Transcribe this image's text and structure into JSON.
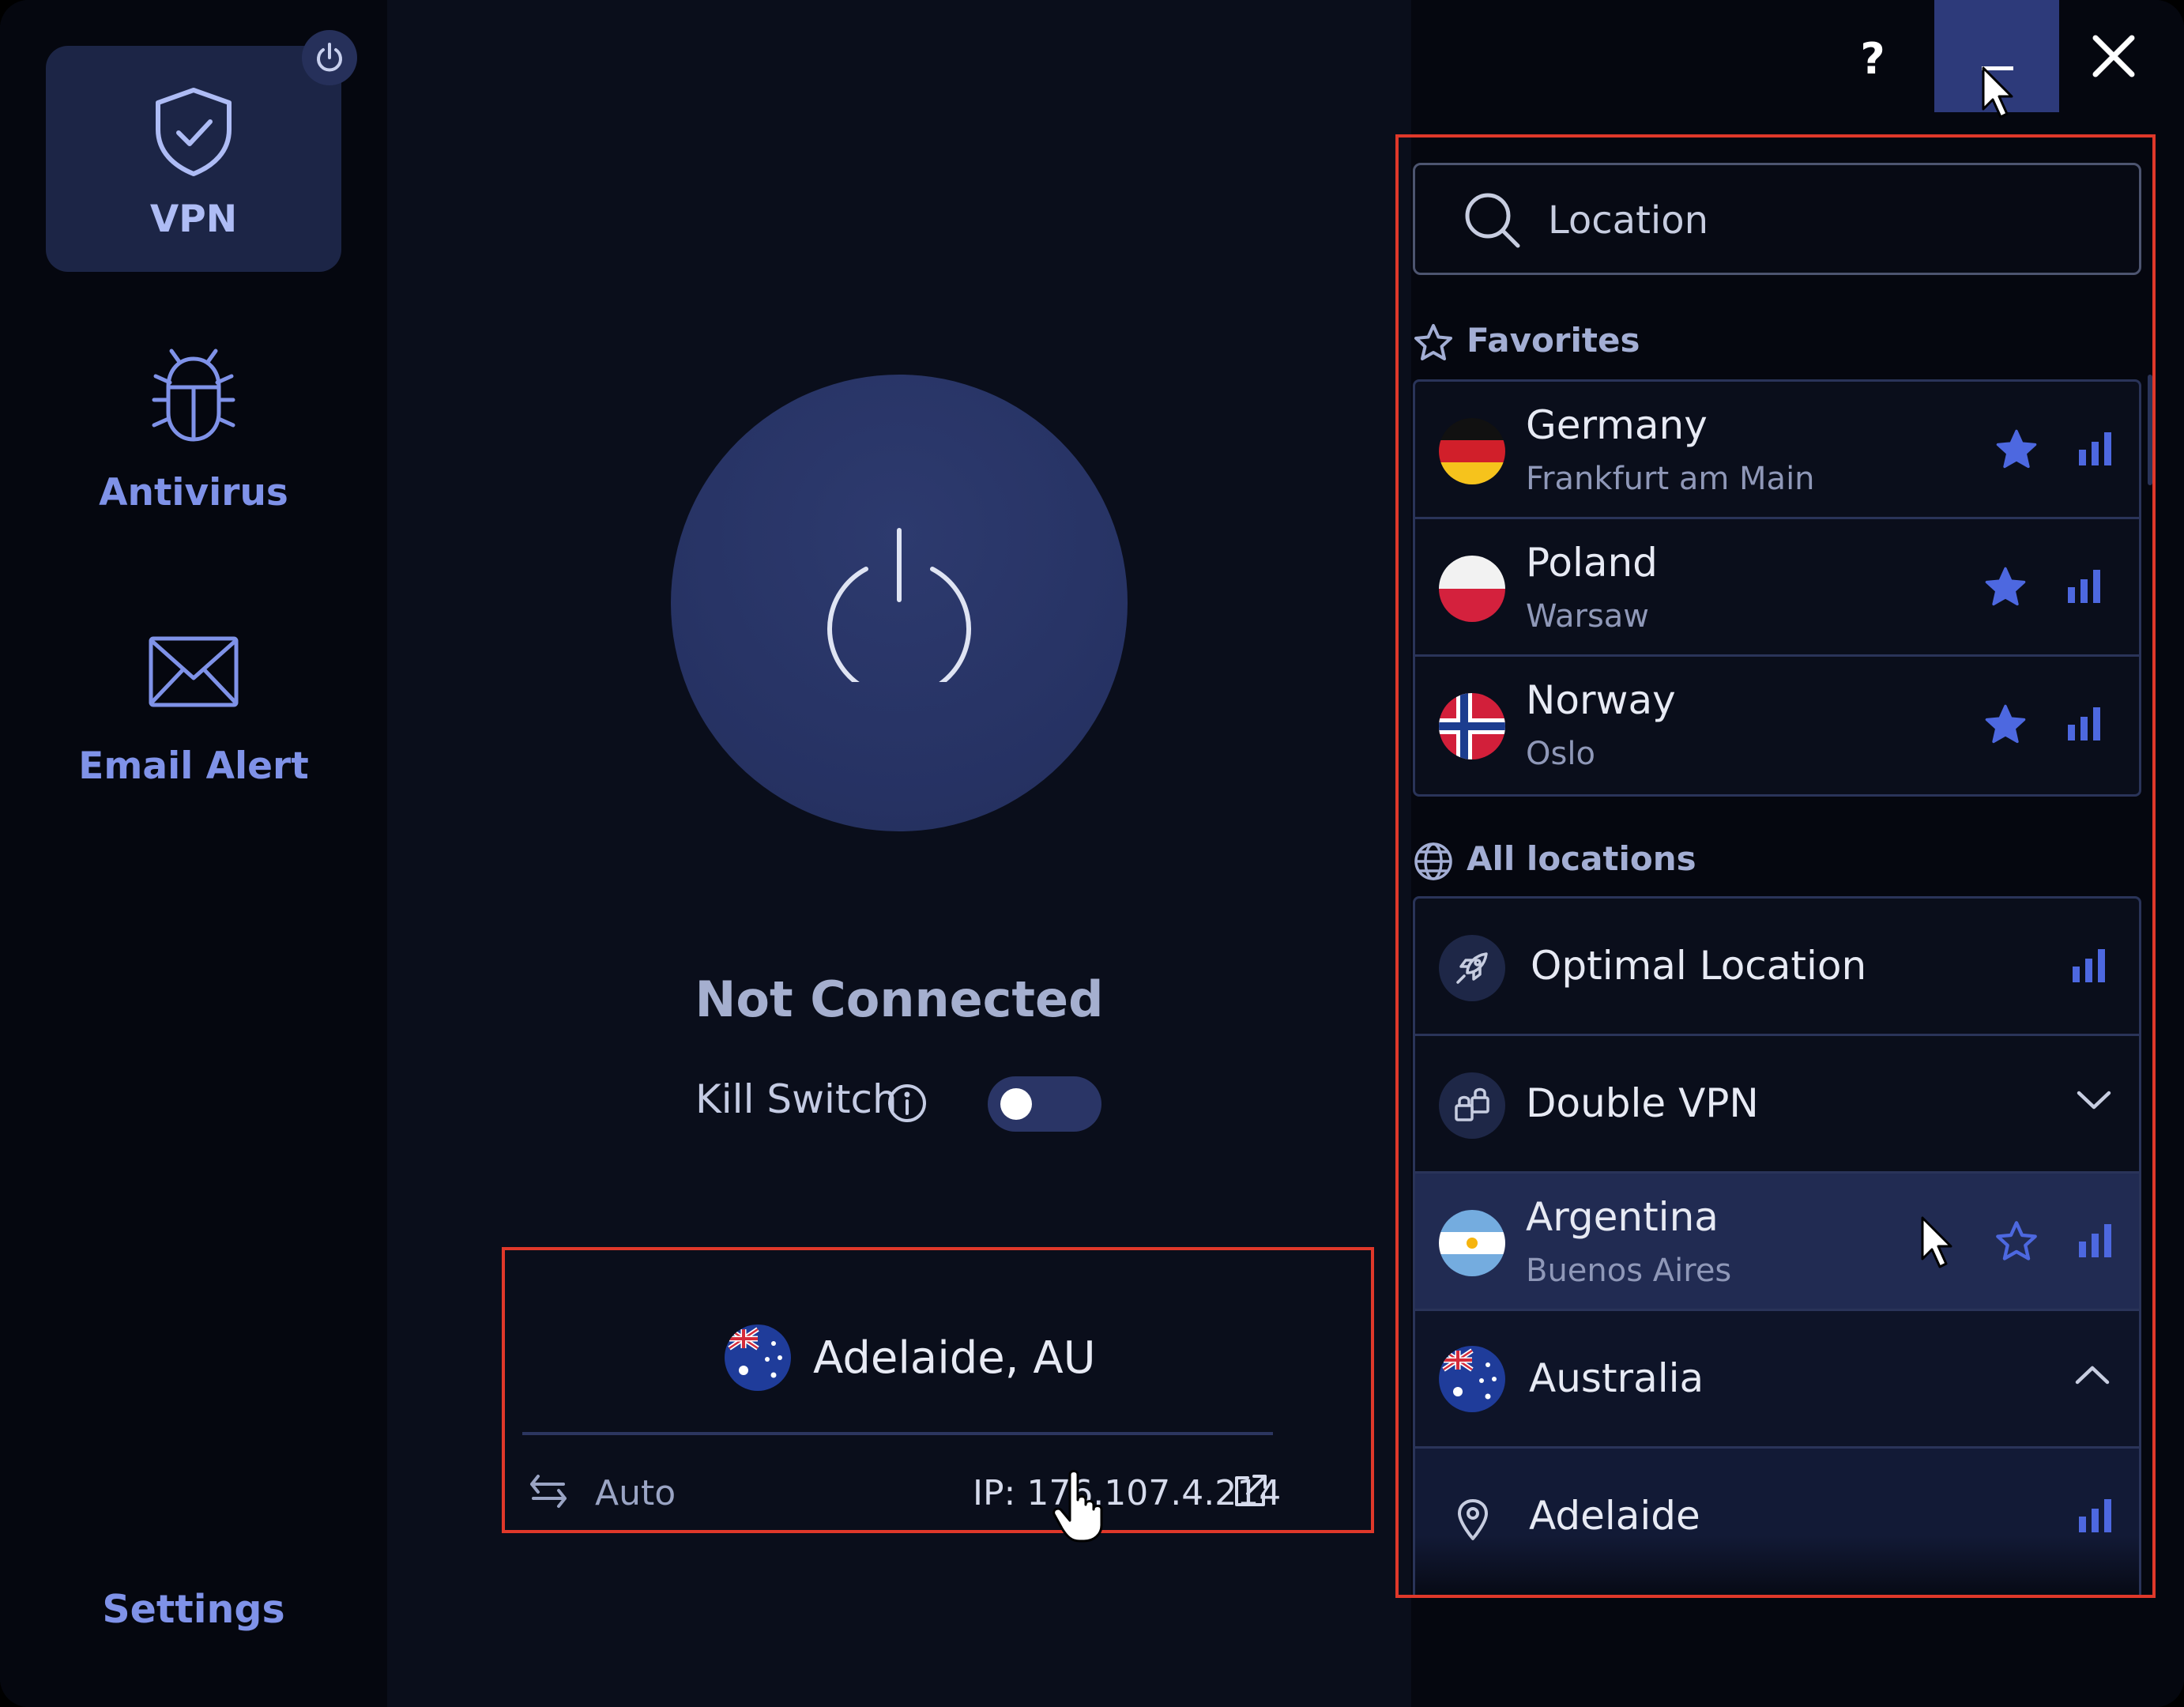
{
  "sidebar": {
    "items": [
      {
        "label": "VPN",
        "icon": "shield-check-icon",
        "active": true
      },
      {
        "label": "Antivirus",
        "icon": "bug-icon",
        "active": false
      },
      {
        "label": "Email Alert",
        "icon": "envelope-icon",
        "active": false
      }
    ],
    "settings_label": "Settings"
  },
  "main": {
    "status": "Not Connected",
    "kill_switch_label": "Kill Switch",
    "kill_switch_on": false,
    "location": {
      "name": "Adelaide, AU",
      "mode": "Auto",
      "ip": "IP: 176.107.4.214"
    }
  },
  "titlebar": {
    "help": "?"
  },
  "panel": {
    "search_placeholder": "Location",
    "favorites_title": "Favorites",
    "favorites": [
      {
        "country": "Germany",
        "city": "Frankfurt am Main",
        "flag": "de",
        "favorite": true
      },
      {
        "country": "Poland",
        "city": "Warsaw",
        "flag": "pl",
        "favorite": true
      },
      {
        "country": "Norway",
        "city": "Oslo",
        "flag": "no",
        "favorite": true
      }
    ],
    "all_title": "All locations",
    "all": [
      {
        "label": "Optimal Location",
        "icon": "rocket-icon"
      },
      {
        "label": "Double VPN",
        "icon": "double-lock-icon"
      },
      {
        "country": "Argentina",
        "city": "Buenos Aires",
        "flag": "ar",
        "favorite": false
      },
      {
        "country": "Australia",
        "flag": "au"
      },
      {
        "city": "Adelaide",
        "icon": "location-pin-icon"
      }
    ]
  },
  "colors": {
    "accent": "#4d68e0",
    "background": "#0a0e1b",
    "highlight": "#e0382a"
  }
}
